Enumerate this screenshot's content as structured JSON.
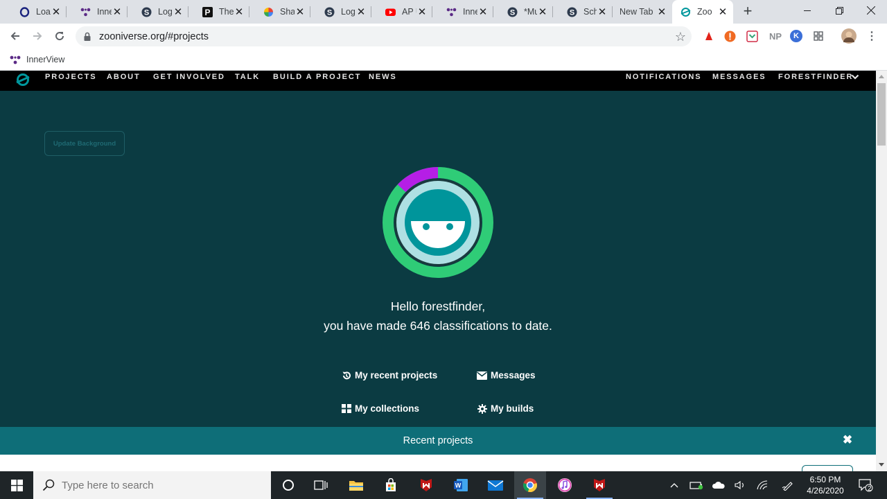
{
  "browser": {
    "tabs": [
      {
        "title": "Loan",
        "icon": "opera-o-icon"
      },
      {
        "title": "InnerView",
        "icon": "innerview-icon"
      },
      {
        "title": "Log",
        "icon": "s-circle-icon"
      },
      {
        "title": "The",
        "icon": "p-square-icon"
      },
      {
        "title": "Shar",
        "icon": "pinwheel-icon"
      },
      {
        "title": "Log",
        "icon": "s-circle-icon"
      },
      {
        "title": "AP U",
        "icon": "youtube-icon"
      },
      {
        "title": "Inne",
        "icon": "innerview-icon"
      },
      {
        "title": "*Mu",
        "icon": "s-circle-icon"
      },
      {
        "title": "Scho",
        "icon": "s-circle-icon"
      },
      {
        "title": "New Tab",
        "icon": ""
      },
      {
        "title": "Zoo",
        "icon": "zooniverse-icon"
      }
    ],
    "url": "zooniverse.org/#projects",
    "bookmarks": [
      {
        "label": "InnerView"
      }
    ],
    "extensions": {
      "np_label": "NP",
      "k_label": "K"
    }
  },
  "zooniverse": {
    "nav_left": [
      "PROJECTS",
      "ABOUT",
      "GET INVOLVED",
      "TALK",
      "BUILD A PROJECT",
      "NEWS"
    ],
    "nav_right": [
      "NOTIFICATIONS",
      "MESSAGES",
      "FORESTFINDER"
    ],
    "update_background": "Update Background",
    "greeting_line1": "Hello forestfinder,",
    "greeting_line2_pre": "you have made ",
    "classification_count": "646",
    "greeting_line2_post": " classifications to date.",
    "progress_fraction": 0.13,
    "colors": {
      "nav_bg": "#000000",
      "page_bg": "#0b3b42",
      "ring_green": "#2fcc77",
      "ring_purple": "#b51ee6",
      "teal": "#0e6e78"
    },
    "links": {
      "recent": "My recent projects",
      "messages": "Messages",
      "collections": "My collections",
      "builds": "My builds"
    },
    "recent_bar_title": "Recent projects"
  },
  "taskbar": {
    "search_placeholder": "Type here to search",
    "time": "6:50 PM",
    "date": "4/26/2020",
    "notification_count": "2"
  }
}
